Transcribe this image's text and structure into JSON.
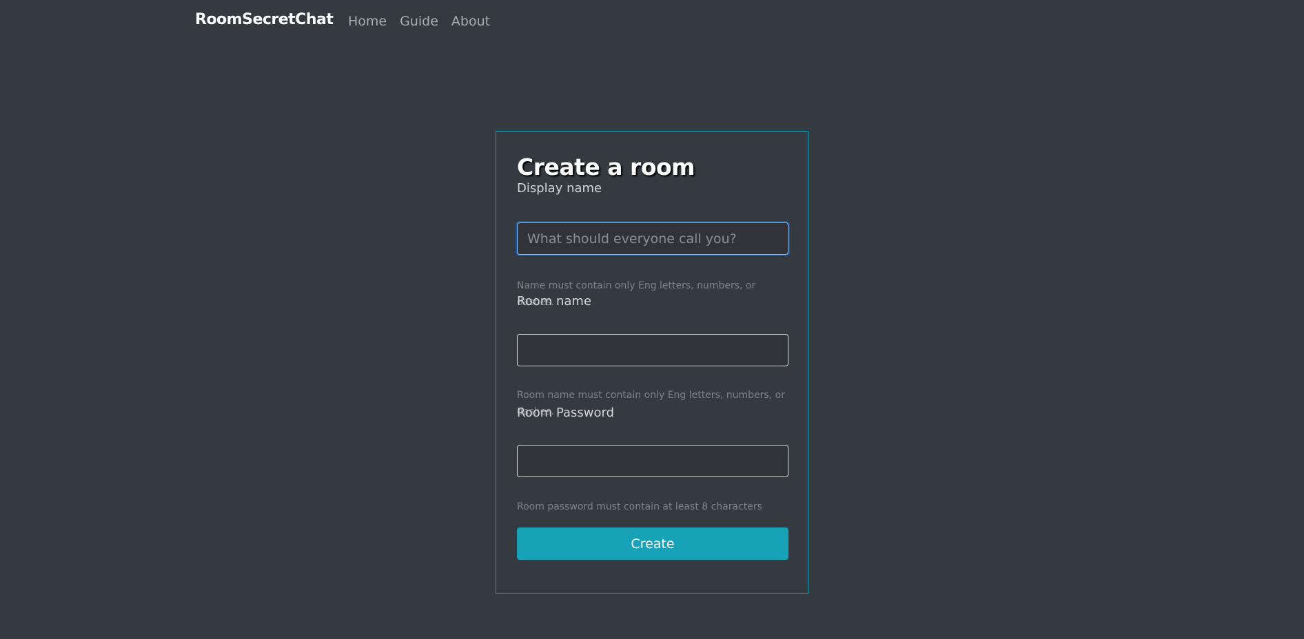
{
  "nav": {
    "brand": "RoomSecretChat",
    "links": [
      "Home",
      "Guide",
      "About"
    ]
  },
  "form": {
    "title": "Create a room",
    "display_name": {
      "label": "Display name",
      "value": "",
      "placeholder": "What should everyone call you?",
      "help": "Name must contain only Eng letters, numbers, or dashes."
    },
    "room_name": {
      "label": "Room name",
      "value": "",
      "placeholder": "",
      "help": "Room name must contain only Eng letters, numbers, or dashes."
    },
    "room_password": {
      "label": "Room Password",
      "value": "",
      "placeholder": "",
      "help": "Room password must contain at least 8 characters"
    },
    "submit_label": "Create"
  },
  "colors": {
    "background": "#343a40",
    "accent": "#17a2b8",
    "focus": "#80bdff"
  }
}
